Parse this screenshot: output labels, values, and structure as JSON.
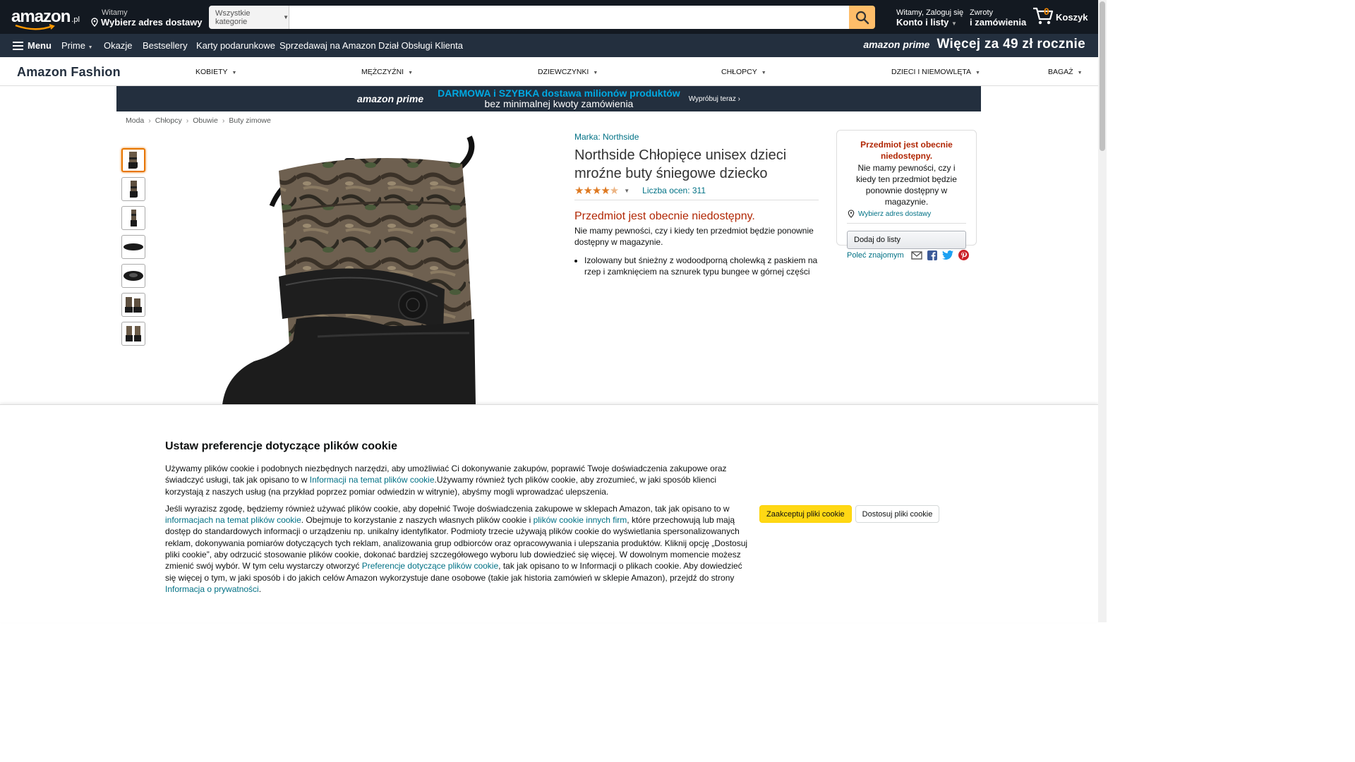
{
  "header": {
    "logo_text": "amazon",
    "logo_tld": ".pl",
    "deliver_line1": "Witamy",
    "deliver_line2": "Wybierz adres dostawy",
    "search_category": "Wszystkie kategorie",
    "search_placeholder": "",
    "account_line1": "Witamy, Zaloguj się",
    "account_line2": "Konto i listy",
    "returns_line1": "Zwroty",
    "returns_line2": "i zamówienia",
    "cart_count": "0",
    "cart_label": "Koszyk"
  },
  "subnav": {
    "menu": "Menu",
    "items": [
      "Prime",
      "Okazje",
      "Bestsellery",
      "Karty podarunkowe",
      "Sprzedawaj na Amazon",
      "Dział Obsługi Klienta"
    ],
    "prime_logo": "amazon prime",
    "prime_promo": "Więcej za 49 zł rocznie"
  },
  "fashion": {
    "logo": "Amazon Fashion",
    "items": [
      "KOBIETY",
      "MĘŻCZYŹNI",
      "DZIEWCZYNKI",
      "CHŁOPCY",
      "DZIECI I NIEMOWLĘTA",
      "BAGAŻ"
    ]
  },
  "banner": {
    "prime": "amazon prime",
    "line1": "DARMOWA i SZYBKA dostawa milionów produktów",
    "line2": "bez minimalnej kwoty zamówienia",
    "cta": "Wypróbuj teraz ›"
  },
  "breadcrumb": [
    "Moda",
    "Chłopcy",
    "Obuwie",
    "Buty zimowe"
  ],
  "product": {
    "brand": "Marka: Northside",
    "title": "Northside Chłopięce unisex dzieci mroźne buty śniegowe dziecko",
    "rating_stars": 4.5,
    "rating_count": "Liczba ocen: 311",
    "unavailable": "Przedmiot jest obecnie niedostępny.",
    "unavailable_desc": "Nie mamy pewności, czy i kiedy ten przedmiot będzie ponownie dostępny w magazynie.",
    "bullets": [
      "Izolowany but śnieżny z wodoodporną cholewką z paskiem na rzep i zamknięciem na sznurek typu bungee w górnej części"
    ]
  },
  "buybox": {
    "title": "Przedmiot jest obecnie niedostępny.",
    "desc": "Nie mamy pewności, czy i kiedy ten przedmiot będzie ponownie dostępny w magazynie.",
    "address": "Wybierz adres dostawy",
    "add_to_list": "Dodaj do listy"
  },
  "share": {
    "label": "Poleć znajomym"
  },
  "cookie": {
    "title": "Ustaw preferencje dotyczące plików cookie",
    "p1_a": "Używamy plików cookie i podobnych niezbędnych narzędzi, aby umożliwiać Ci dokonywanie zakupów, poprawić Twoje doświadczenia zakupowe oraz świadczyć usługi, tak jak opisano to w ",
    "p1_link": "Informacji na temat plików cookie",
    "p1_b": ".Używamy również tych plików cookie, aby zrozumieć, w jaki sposób klienci korzystają z naszych usług (na przykład poprzez pomiar odwiedzin w witrynie), abyśmy mogli wprowadzać ulepszenia.",
    "p2_a": "Jeśli wyrazisz zgodę, będziemy również używać plików cookie, aby dopełnić Twoje doświadczenia zakupowe w sklepach Amazon, tak jak opisano to w ",
    "p2_link1": "informacjach na temat plików cookie",
    "p2_b": ". Obejmuje to korzystanie z naszych własnych plików cookie i ",
    "p2_link2": "plików cookie innych firm",
    "p2_c": ", które przechowują lub mają dostęp do standardowych informacji o urządzeniu np. unikalny identyfikator. Podmioty trzecie używają plików cookie do wyświetlania spersonalizowanych reklam, dokonywania pomiarów dotyczących tych reklam, analizowania grup odbiorców oraz opracowywania i ulepszania produktów. Kliknij opcję „Dostosuj pliki cookie”, aby odrzucić stosowanie plików cookie, dokonać bardziej szczegółowego wyboru lub dowiedzieć się więcej. W dowolnym momencie możesz zmienić swój wybór. W tym celu wystarczy otworzyć ",
    "p2_link3": "Preferencje dotyczące plików cookie",
    "p2_d": ", tak jak opisano to w Informacji o plikach cookie. Aby dowiedzieć się więcej o tym, w jaki sposób i do jakich celów Amazon wykorzystuje dane osobowe (takie jak historia zamówień w sklepie Amazon), przejdź do strony ",
    "p2_link4": "Informacja o prywatności",
    "p2_e": ".",
    "accept": "Zaakceptuj pliki cookie",
    "customize": "Dostosuj pliki cookie"
  },
  "colors": {
    "nav_dark": "#131921",
    "nav_sub": "#232f3e",
    "search_btn": "#febd69",
    "link": "#007185",
    "unavailable": "#b12704",
    "accept_btn": "#ffd814",
    "prime_blue": "#00a8e1"
  }
}
